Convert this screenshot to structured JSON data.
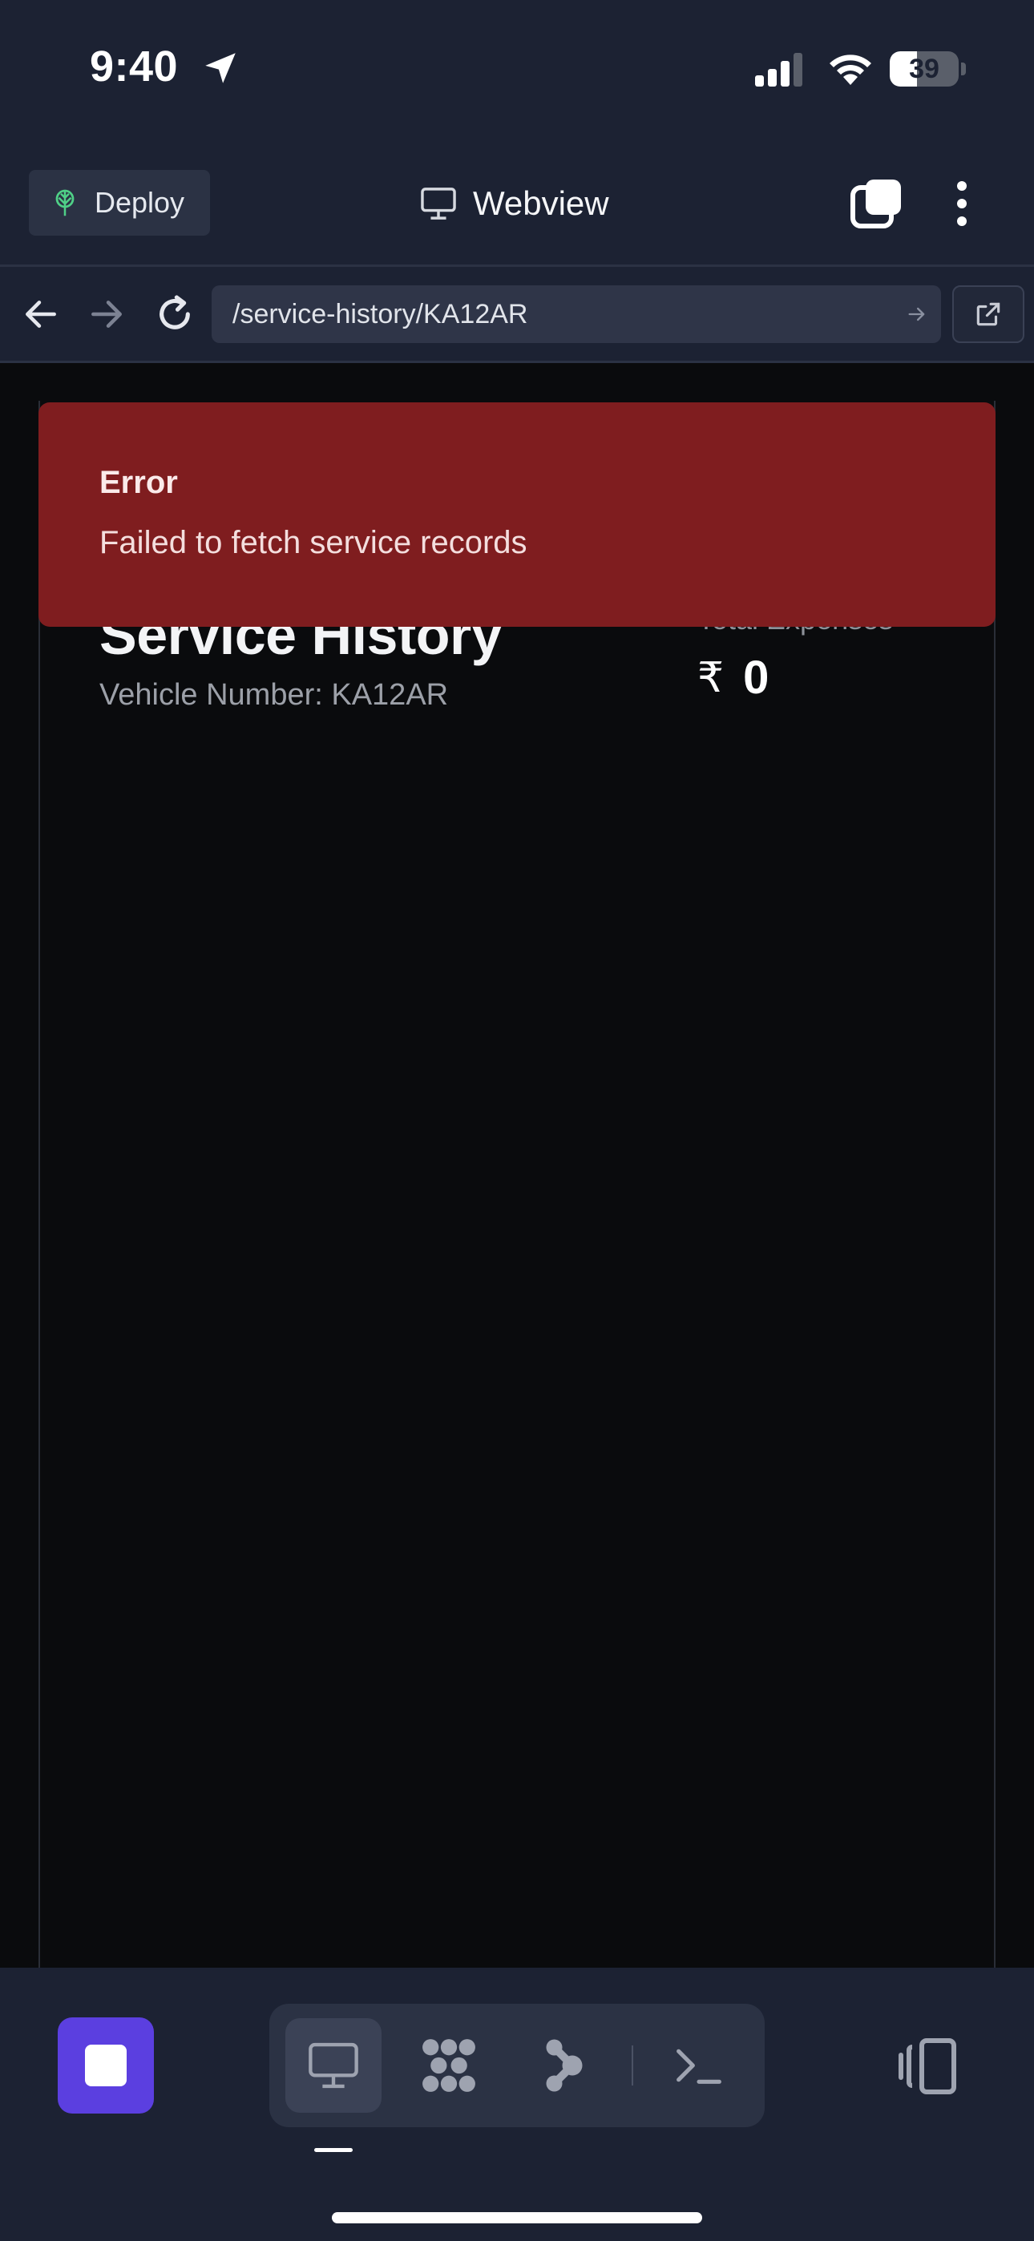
{
  "status_bar": {
    "time": "9:40",
    "battery_level": "39",
    "battery_fraction": 0.39
  },
  "toolbar": {
    "deploy_label": "Deploy",
    "title": "Webview"
  },
  "nav": {
    "url": "/service-history/KA12AR"
  },
  "page": {
    "title": "Service History",
    "vehicle_line": "Vehicle Number: KA12AR",
    "expense_label": "Total Expenses",
    "currency_symbol": "₹",
    "expense_value": "0"
  },
  "toast": {
    "title": "Error",
    "message": "Failed to fetch service records",
    "background_color": "#7f1d1f"
  },
  "bottom_bar": {
    "tools": [
      "webview-icon",
      "workflow-icon",
      "agent-icon",
      "terminal-icon"
    ],
    "active_tool": "webview-icon",
    "stop_color": "#5b3fe0"
  }
}
